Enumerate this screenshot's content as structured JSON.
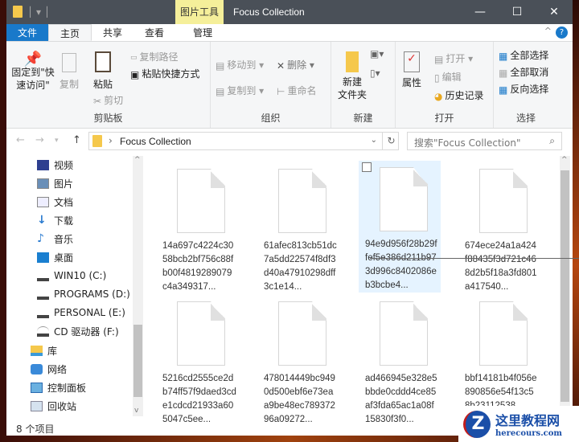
{
  "window": {
    "title": "Focus Collection",
    "context_tab": "图片工具",
    "minimize": "—",
    "maximize": "☐",
    "close": "✕"
  },
  "tabs": [
    {
      "label": "文件"
    },
    {
      "label": "主页"
    },
    {
      "label": "共享"
    },
    {
      "label": "查看"
    },
    {
      "label": "管理"
    }
  ],
  "ribbon": {
    "clipboard": {
      "label": "剪贴板",
      "pin": "固定到\"快速访问\"",
      "copy": "复制",
      "paste": "粘贴",
      "copy_path": "复制路径",
      "paste_shortcut": "粘贴快捷方式",
      "cut": "剪切"
    },
    "organize": {
      "label": "组织",
      "move_to": "移动到",
      "copy_to": "复制到",
      "delete": "删除",
      "rename": "重命名"
    },
    "new": {
      "label": "新建",
      "new_folder": "新建\n文件夹"
    },
    "open": {
      "label": "打开",
      "properties": "属性",
      "open": "打开",
      "edit": "编辑",
      "history": "历史记录"
    },
    "select": {
      "label": "选择",
      "select_all": "全部选择",
      "select_none": "全部取消",
      "invert": "反向选择"
    }
  },
  "address": {
    "path": "Focus Collection",
    "search_placeholder": "搜索\"Focus Collection\""
  },
  "nav": [
    {
      "label": "视频",
      "icon": "video-icon"
    },
    {
      "label": "图片",
      "icon": "pictures-icon"
    },
    {
      "label": "文档",
      "icon": "documents-icon"
    },
    {
      "label": "下载",
      "icon": "download-icon"
    },
    {
      "label": "音乐",
      "icon": "music-icon"
    },
    {
      "label": "桌面",
      "icon": "desktop-icon"
    },
    {
      "label": "WIN10 (C:)",
      "icon": "drive-icon"
    },
    {
      "label": "PROGRAMS (D:)",
      "icon": "drive-icon"
    },
    {
      "label": "PERSONAL (E:)",
      "icon": "drive-icon"
    },
    {
      "label": "CD 驱动器 (F:)",
      "icon": "cd-drive-icon"
    },
    {
      "label": "库",
      "icon": "library-icon"
    },
    {
      "label": "网络",
      "icon": "network-icon"
    },
    {
      "label": "控制面板",
      "icon": "control-panel-icon"
    },
    {
      "label": "回收站",
      "icon": "recycle-bin-icon"
    }
  ],
  "files": [
    {
      "name": "14a697c4224c3058bcb2bf756c88fb00f4819289079c4a349317..."
    },
    {
      "name": "61afec813cb51dc7a5dd22574f8df3d40a47910298dff3c1e14..."
    },
    {
      "name": "94e9d956f28b29ffef5e386d211b973d996c8402086eb3bcbe4..."
    },
    {
      "name": "674ece24a1a424f88435f3d721c468d2b5f18a3fd801a417540..."
    },
    {
      "name": "5216cd2555ce2db74ff57f9daed3cde1cdcd21933a605047c5ee..."
    },
    {
      "name": "478014449bc9490d500ebf6e73eaa9be48ec78937296a09272..."
    },
    {
      "name": "ad466945e328e5bbde0cddd4ce85af3fda65ac1a08f15830f3f0..."
    },
    {
      "name": "bbf14181b4f056e890856e54f13c58b23112538"
    }
  ],
  "status": "8 个项目",
  "watermark": {
    "title": "这里教程网",
    "url": "herecours.com"
  }
}
